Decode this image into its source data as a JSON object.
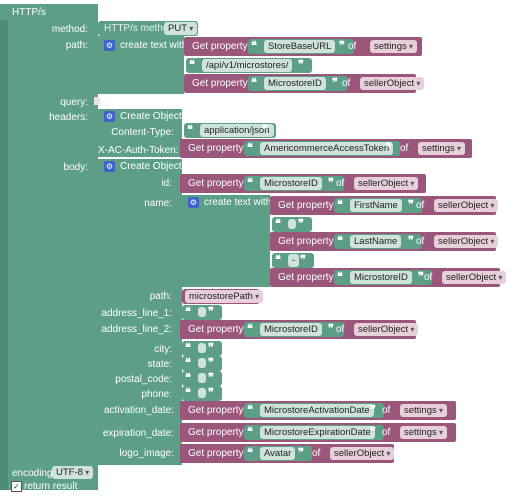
{
  "block": {
    "title": "HTTP/s",
    "method_label": "method:",
    "method_text": "HTTP/s method",
    "method_value": "PUT",
    "path_label": "path:",
    "query_label": "query:",
    "headers_label": "headers:",
    "body_label": "body:",
    "encoding_label": "encoding:",
    "encoding_value": "UTF-8",
    "return_label": "return result"
  },
  "path": {
    "create_text": "create text with",
    "get_property": "Get property",
    "of": "of",
    "p1": "StoreBaseURL",
    "p1_obj": "settings",
    "literal": "/api/v1/microstores/",
    "p3": "MicrostoreID",
    "p3_obj": "sellerObject"
  },
  "headers": {
    "create_object": "Create Object",
    "content_type_label": "Content-Type:",
    "content_type_value": "application/json",
    "token_label": "X-AC-Auth-Token:",
    "token_prop": "AmericommerceAccessToken",
    "token_obj": "settings"
  },
  "body": {
    "create_object": "Create Object",
    "id_label": "id:",
    "id_prop": "MicrostoreID",
    "id_obj": "sellerObject",
    "name_label": "name:",
    "name_create": "create text with",
    "first_name": "FirstName",
    "first_obj": "sellerObject",
    "last_name": "LastName",
    "last_obj": "sellerObject",
    "dash": "-",
    "ms_id": "MicrostoreID",
    "ms_obj": "sellerObject",
    "path_label": "path:",
    "path_value": "microstorePath",
    "addr1_label": "address_line_1:",
    "addr2_label": "address_line_2:",
    "addr2_prop": "MicrostoreID",
    "addr2_obj": "sellerObject",
    "city_label": "city:",
    "state_label": "state:",
    "postal_label": "postal_code:",
    "phone_label": "phone:",
    "activation_label": "activation_date:",
    "activation_prop": "MicrostoreActivationDate",
    "activation_obj": "settings",
    "expiration_label": "expiration_date:",
    "expiration_prop": "MicrostoreExpirationDate",
    "expiration_obj": "settings",
    "logo_label": "logo_image:",
    "logo_prop": "Avatar",
    "logo_obj": "sellerObject"
  },
  "colors": {
    "green": "#5c9e86",
    "purple": "#9b567c",
    "gear": "#3d63c9"
  },
  "icons": [
    "gear-icon",
    "checkbox-icon",
    "dropdown-arrow-icon",
    "quote-icon"
  ]
}
